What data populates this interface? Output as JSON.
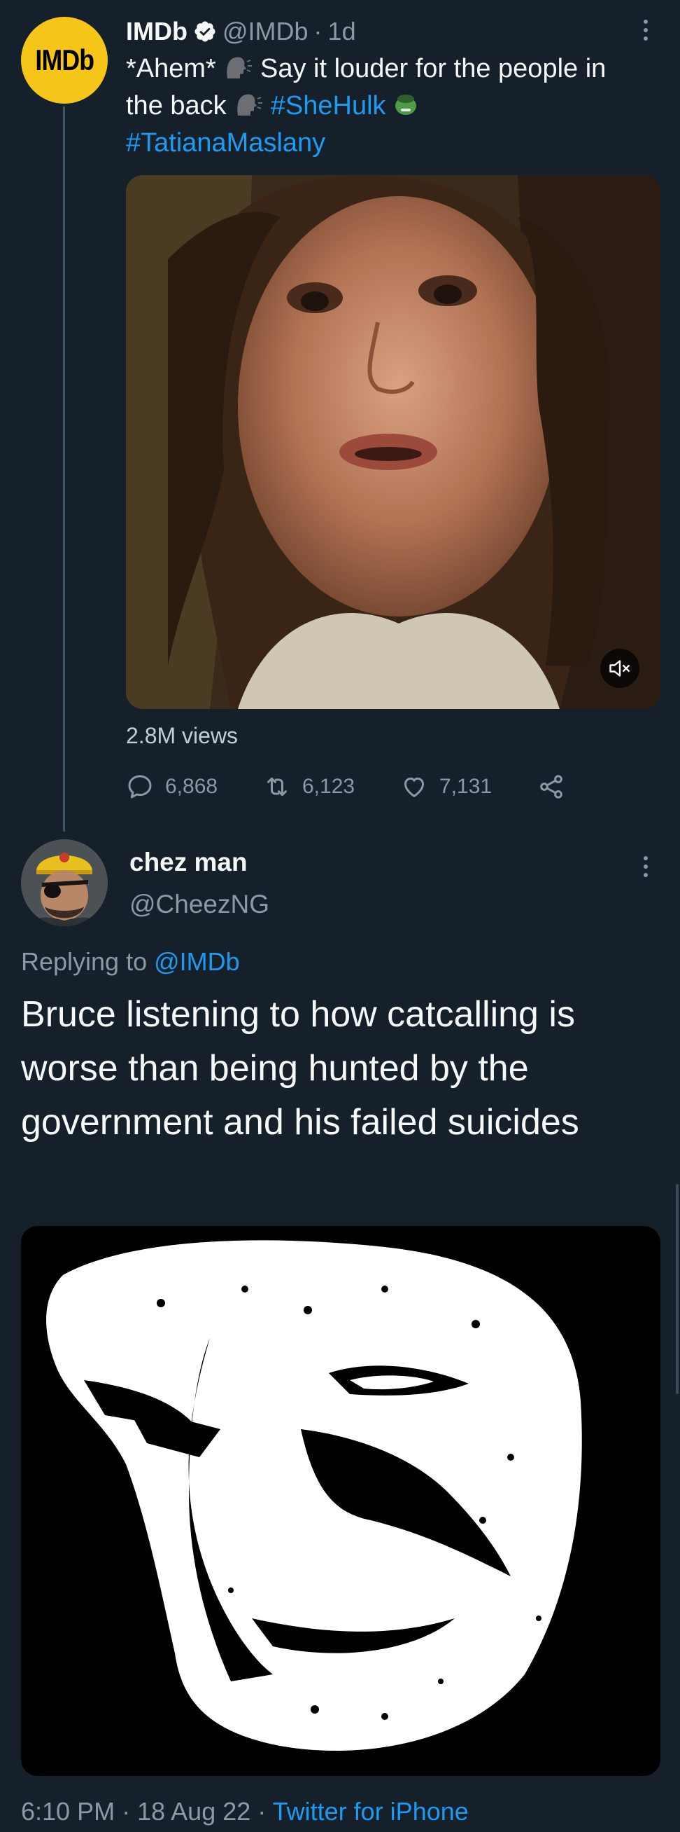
{
  "tweet": {
    "avatar_text": "IMDb",
    "author_name": "IMDb",
    "handle": "@IMDb",
    "separator": "·",
    "age": "1d",
    "text_line1_a": "*Ahem*",
    "text_line1_b": "Say it louder for the people in",
    "text_line2_a": "the back",
    "hashtag1": "#SheHulk",
    "hashtag2": "#TatianaMaslany",
    "views": "2.8M views",
    "replies": "6,868",
    "retweets": "6,123",
    "likes": "7,131"
  },
  "reply": {
    "author_name": "chez man",
    "handle": "@CheezNG",
    "replying_to_label": "Replying to",
    "replying_to_handle": "@IMDb",
    "text": "Bruce listening to how catcalling is worse than being hunted by the government and his failed suicides",
    "time": "6:10 PM",
    "sep1": "·",
    "date": "18 Aug 22",
    "sep2": "·",
    "client": "Twitter for iPhone"
  },
  "colors": {
    "background": "#15202b",
    "accent": "#1d9bf0",
    "muted": "#8b98a5",
    "imdb_yellow": "#f5c518"
  }
}
